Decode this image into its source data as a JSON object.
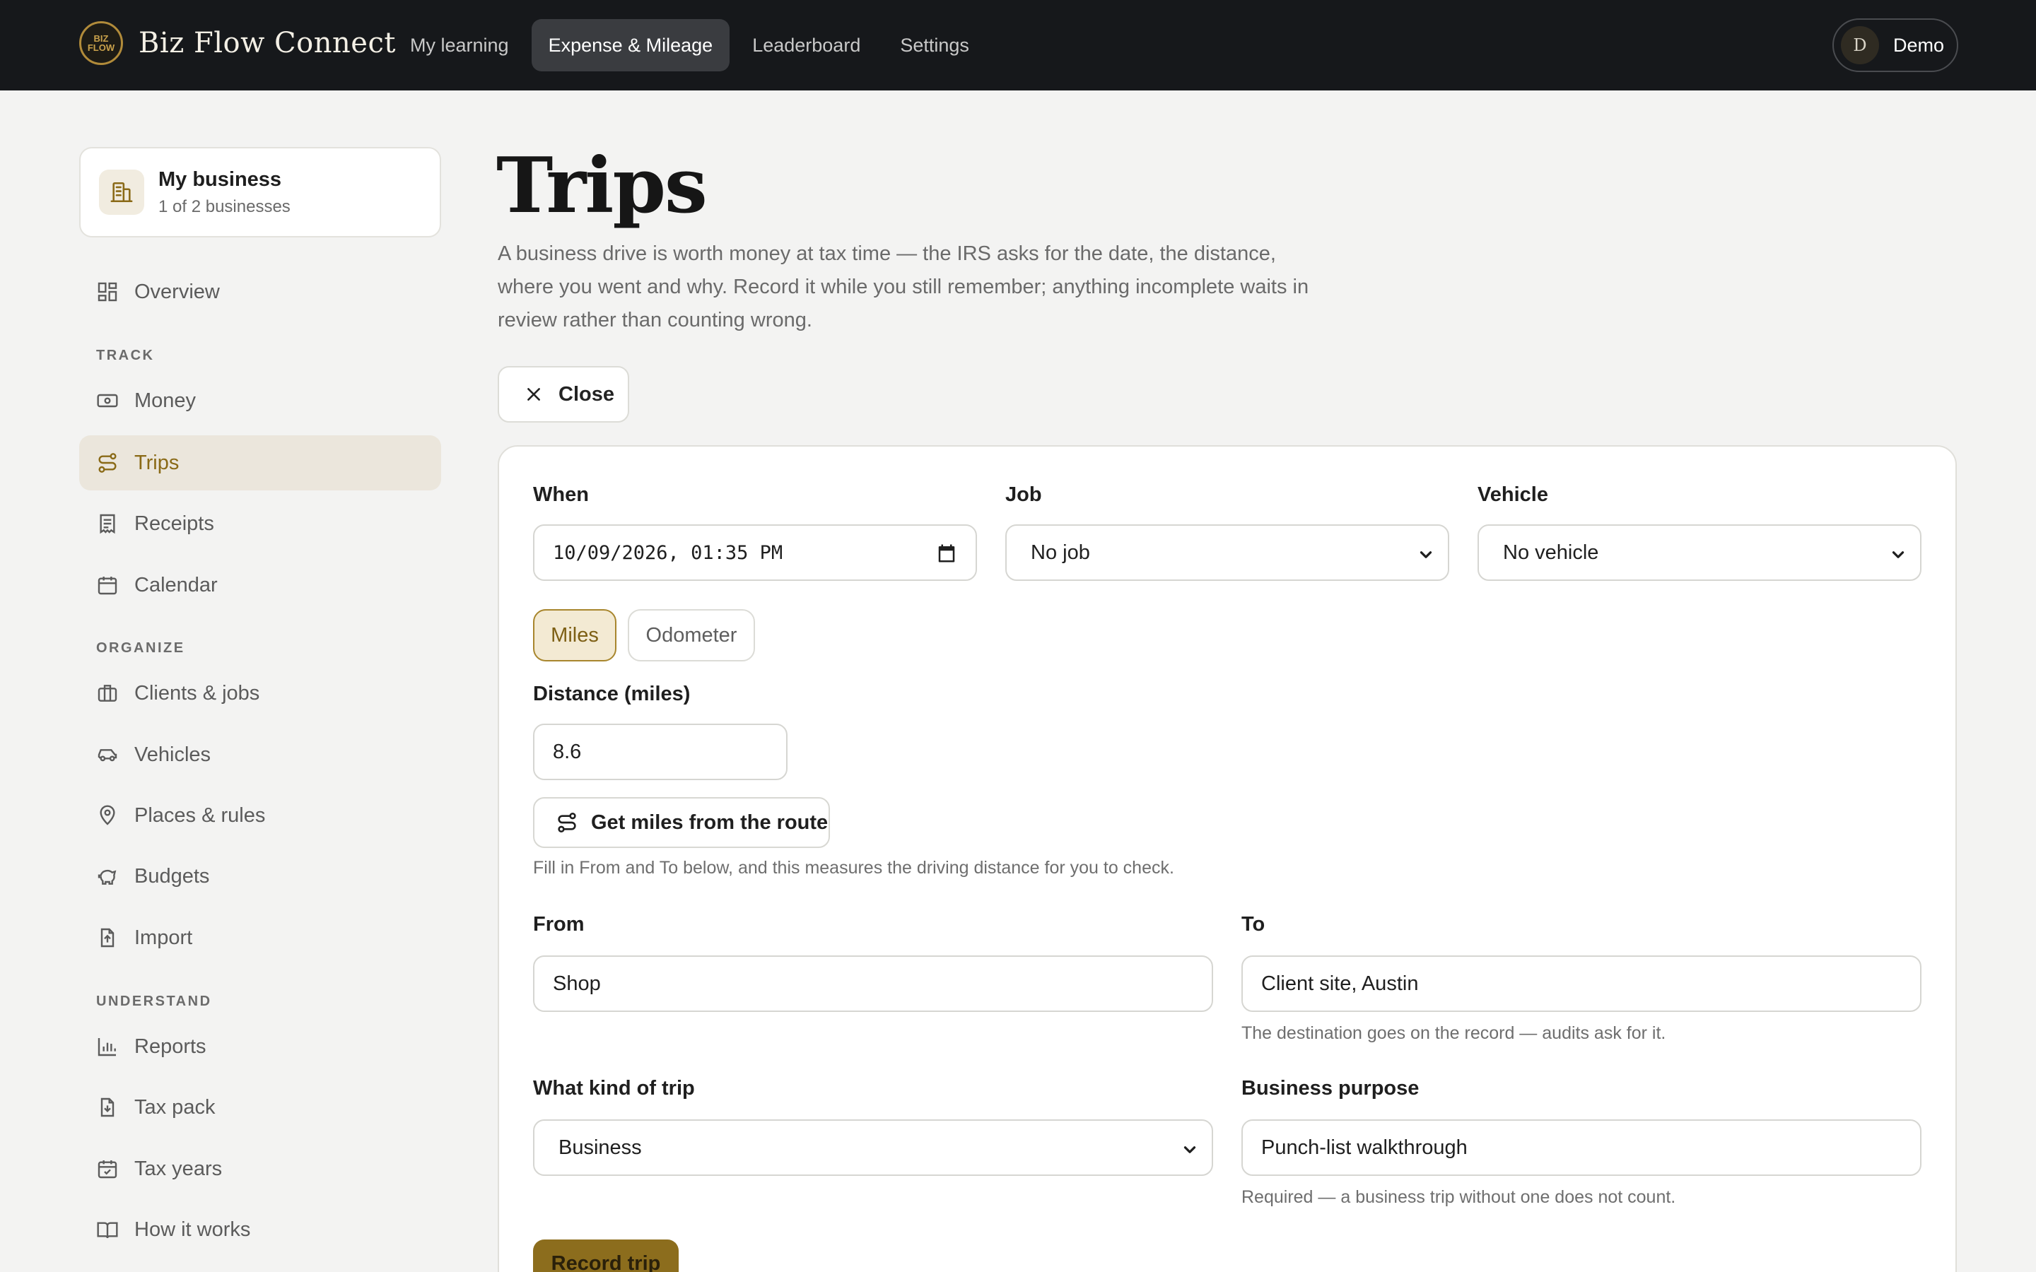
{
  "app": {
    "title": "Biz Flow Connect",
    "logo_text": "BIZ FLOW CONNECT"
  },
  "nav": {
    "items": [
      {
        "label": "My learning",
        "active": false
      },
      {
        "label": "Expense & Mileage",
        "active": true
      },
      {
        "label": "Leaderboard",
        "active": false
      },
      {
        "label": "Settings",
        "active": false
      }
    ]
  },
  "user": {
    "initial": "D",
    "name": "Demo"
  },
  "business": {
    "name": "My business",
    "subtitle": "1 of 2 businesses"
  },
  "sidebar": {
    "overview": "Overview",
    "sections": {
      "track": "TRACK",
      "organize": "ORGANIZE",
      "understand": "UNDERSTAND"
    },
    "items": [
      {
        "label": "Money",
        "icon": "money-icon"
      },
      {
        "label": "Trips",
        "icon": "route-icon",
        "active": true
      },
      {
        "label": "Receipts",
        "icon": "receipt-icon"
      },
      {
        "label": "Calendar",
        "icon": "calendar-icon"
      },
      {
        "label": "Clients & jobs",
        "icon": "briefcase-icon"
      },
      {
        "label": "Vehicles",
        "icon": "car-icon"
      },
      {
        "label": "Places & rules",
        "icon": "location-pin-icon"
      },
      {
        "label": "Budgets",
        "icon": "piggy-bank-icon"
      },
      {
        "label": "Import",
        "icon": "file-upload-icon"
      },
      {
        "label": "Reports",
        "icon": "bar-chart-icon"
      },
      {
        "label": "Tax pack",
        "icon": "file-download-icon"
      },
      {
        "label": "Tax years",
        "icon": "calendar-check-icon"
      },
      {
        "label": "How it works",
        "icon": "book-icon"
      }
    ]
  },
  "page": {
    "title": "Trips",
    "description": "A business drive is worth money at tax time — the IRS asks for the date, the distance, where you went and why. Record it while you still remember; anything incomplete waits in review rather than counting wrong.",
    "close_label": "Close"
  },
  "form": {
    "when": {
      "label": "When",
      "value": "10/09/2026, 01:35 PM"
    },
    "job": {
      "label": "Job",
      "value": "No job"
    },
    "vehicle": {
      "label": "Vehicle",
      "value": "No vehicle"
    },
    "mode": {
      "options": [
        "Miles",
        "Odometer"
      ],
      "selected": "Miles"
    },
    "distance": {
      "label": "Distance (miles)",
      "value": "8.6"
    },
    "route_button": "Get miles from the route",
    "route_hint": "Fill in From and To below, and this measures the driving distance for you to check.",
    "from": {
      "label": "From",
      "value": "Shop"
    },
    "to": {
      "label": "To",
      "value": "Client site, Austin",
      "hint": "The destination goes on the record — audits ask for it."
    },
    "trip_kind": {
      "label": "What kind of trip",
      "value": "Business"
    },
    "purpose": {
      "label": "Business purpose",
      "value": "Punch-list walkthrough",
      "hint": "Required — a business trip without one does not count."
    },
    "submit": "Record trip"
  },
  "colors": {
    "topbar": "#16181b",
    "accent": "#8c6d1d",
    "active_bg": "#ebe6dc",
    "background": "#f3f3f2"
  }
}
